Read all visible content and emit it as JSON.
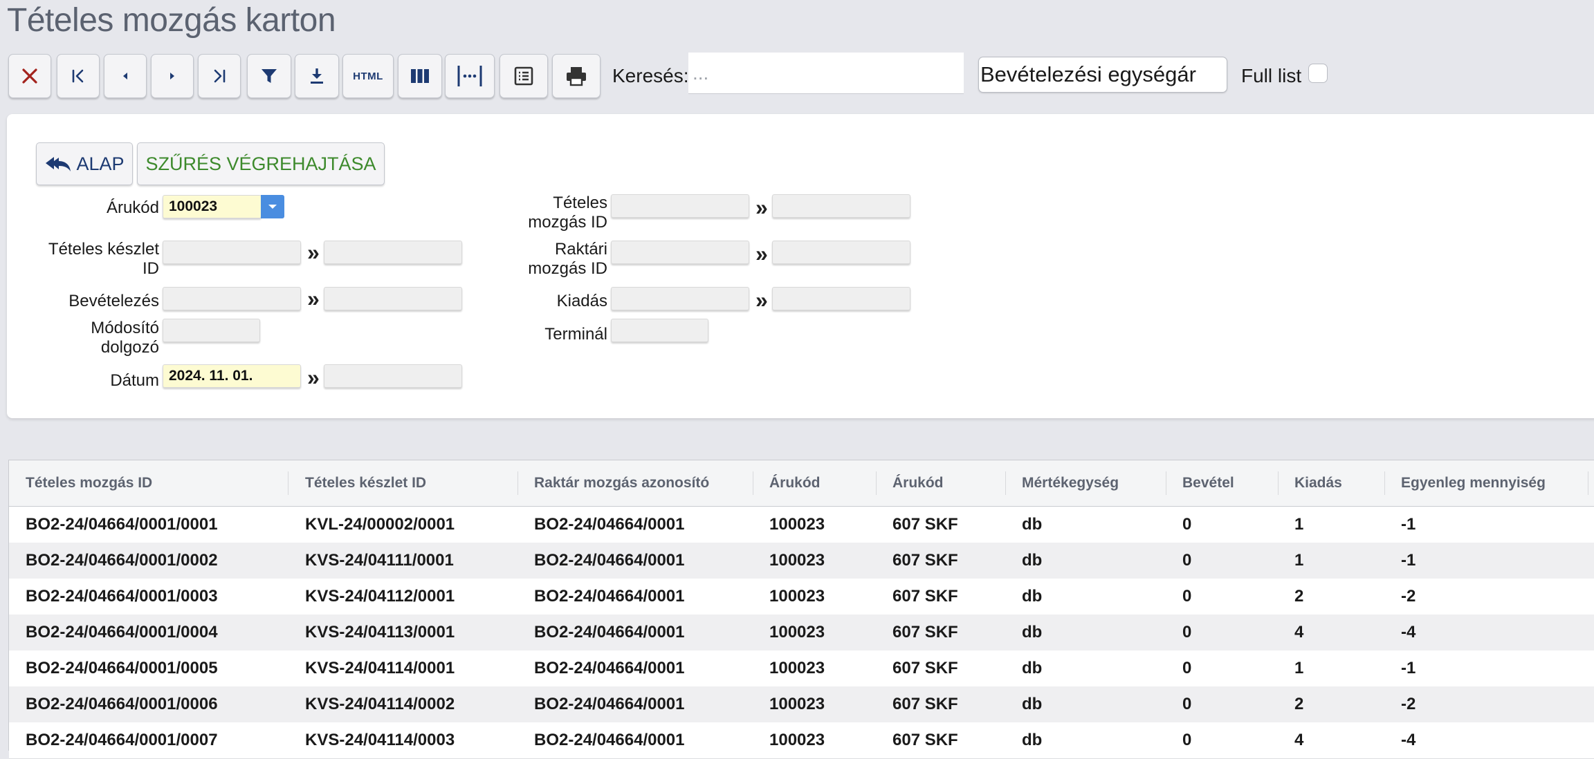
{
  "page": {
    "title": "Tételes mozgás karton"
  },
  "toolbar": {
    "html_label": "HTML",
    "search_label": "Keresés:",
    "search_placeholder": "...",
    "price_select_value": "Bevételezési egységár",
    "full_list_label": "Full list"
  },
  "filters": {
    "alap_label": "ALAP",
    "apply_label": "SZŰRÉS VÉGREHAJTÁSA",
    "arukod_label": "Árukód",
    "arukod_value": "100023",
    "teteles_keszlet_label": "Tételes készlet ID",
    "bevetelezes_label": "Bevételezés",
    "modosito_label": "Módosító dolgozó",
    "datum_label": "Dátum",
    "datum_from": "2024. 11. 01.",
    "teteles_mozgas_label": "Tételes mozgás ID",
    "raktari_mozgas_label": "Raktári mozgás ID",
    "kiadas_label": "Kiadás",
    "terminal_label": "Terminál",
    "range_arrow": "»"
  },
  "grid": {
    "columns": [
      "Tételes mozgás ID",
      "Tételes készlet ID",
      "Raktár mozgás azonosító",
      "Árukód",
      "Árukód",
      "Mértékegység",
      "Bevétel",
      "Kiadás",
      "Egyenleg mennyiség"
    ],
    "rows": [
      [
        "BO2-24/04664/0001/0001",
        "KVL-24/00002/0001",
        "BO2-24/04664/0001",
        "100023",
        "607 SKF",
        "db",
        "0",
        "1",
        "-1"
      ],
      [
        "BO2-24/04664/0001/0002",
        "KVS-24/04111/0001",
        "BO2-24/04664/0001",
        "100023",
        "607 SKF",
        "db",
        "0",
        "1",
        "-1"
      ],
      [
        "BO2-24/04664/0001/0003",
        "KVS-24/04112/0001",
        "BO2-24/04664/0001",
        "100023",
        "607 SKF",
        "db",
        "0",
        "2",
        "-2"
      ],
      [
        "BO2-24/04664/0001/0004",
        "KVS-24/04113/0001",
        "BO2-24/04664/0001",
        "100023",
        "607 SKF",
        "db",
        "0",
        "4",
        "-4"
      ],
      [
        "BO2-24/04664/0001/0005",
        "KVS-24/04114/0001",
        "BO2-24/04664/0001",
        "100023",
        "607 SKF",
        "db",
        "0",
        "1",
        "-1"
      ],
      [
        "BO2-24/04664/0001/0006",
        "KVS-24/04114/0002",
        "BO2-24/04664/0001",
        "100023",
        "607 SKF",
        "db",
        "0",
        "2",
        "-2"
      ],
      [
        "BO2-24/04664/0001/0007",
        "KVS-24/04114/0003",
        "BO2-24/04664/0001",
        "100023",
        "607 SKF",
        "db",
        "0",
        "4",
        "-4"
      ]
    ]
  },
  "icons": [
    "close-icon",
    "first-page-icon",
    "prev-icon",
    "next-icon",
    "last-page-icon",
    "filter-icon",
    "download-icon",
    "columns-icon",
    "column-width-icon",
    "details-icon",
    "print-icon",
    "reply-all-icon",
    "dropdown-caret-icon"
  ],
  "colors": {
    "accent": "#1d3a72",
    "close": "#a3231d",
    "apply": "#3d8a2c",
    "dropdown": "#4a8de0",
    "highlight": "#fdfbd2"
  }
}
